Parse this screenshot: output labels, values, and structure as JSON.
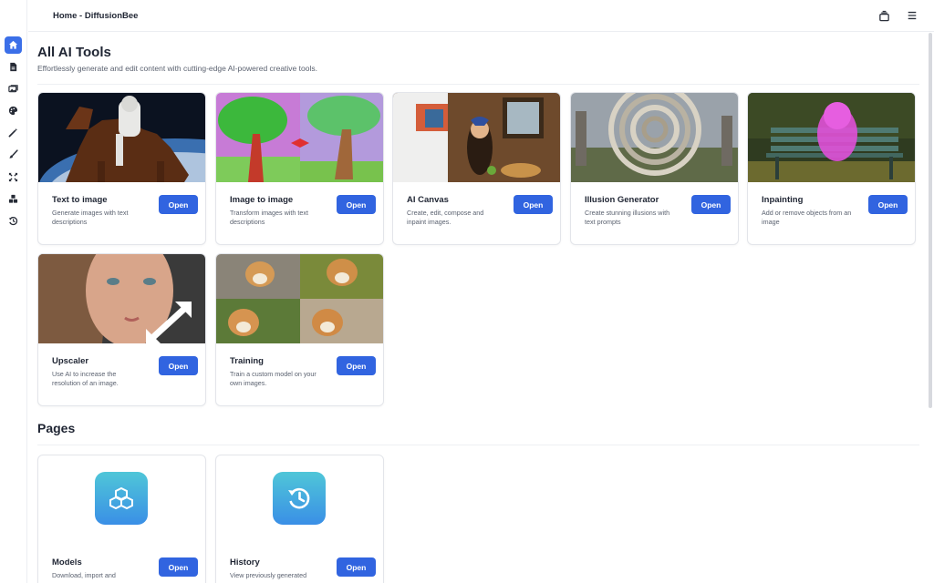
{
  "window": {
    "title": "Home - DiffusionBee"
  },
  "sidebar": {
    "items": [
      {
        "icon": "home-icon",
        "active": true
      },
      {
        "icon": "document-icon",
        "active": false
      },
      {
        "icon": "images-icon",
        "active": false
      },
      {
        "icon": "palette-icon",
        "active": false
      },
      {
        "icon": "magic-wand-icon",
        "active": false
      },
      {
        "icon": "brush-icon",
        "active": false
      },
      {
        "icon": "expand-icon",
        "active": false
      },
      {
        "icon": "cubes-icon",
        "active": false
      },
      {
        "icon": "history-icon",
        "active": false
      }
    ]
  },
  "topbar": {
    "icons": [
      "stack-icon",
      "menu-icon"
    ]
  },
  "tools": {
    "heading": "All AI Tools",
    "subtitle": "Effortlessly generate and edit content with cutting-edge AI-powered creative tools.",
    "cards": [
      {
        "name": "Text to image",
        "desc": "Generate images with text descriptions",
        "button": "Open"
      },
      {
        "name": "Image to image",
        "desc": "Transform images with text descriptions",
        "button": "Open"
      },
      {
        "name": "AI Canvas",
        "desc": "Create, edit, compose and inpaint images.",
        "button": "Open"
      },
      {
        "name": "Illusion Generator",
        "desc": "Create stunning illusions with text prompts",
        "button": "Open"
      },
      {
        "name": "Inpainting",
        "desc": "Add or remove objects from an image",
        "button": "Open"
      },
      {
        "name": "Upscaler",
        "desc": "Use AI to increase the resolution of an image.",
        "button": "Open"
      },
      {
        "name": "Training",
        "desc": "Train a custom model on your own images.",
        "button": "Open"
      }
    ]
  },
  "pages": {
    "heading": "Pages",
    "cards": [
      {
        "name": "Models",
        "desc": "Download, import and",
        "button": "Open",
        "icon": "cubes-icon"
      },
      {
        "name": "History",
        "desc": "View previously generated",
        "button": "Open",
        "icon": "history-icon"
      }
    ]
  },
  "colors": {
    "accent": "#3164e0",
    "sidebar_active": "#3b6fe8",
    "tile_gradient_top": "#4fc6d8",
    "tile_gradient_bottom": "#3a8fe6"
  }
}
